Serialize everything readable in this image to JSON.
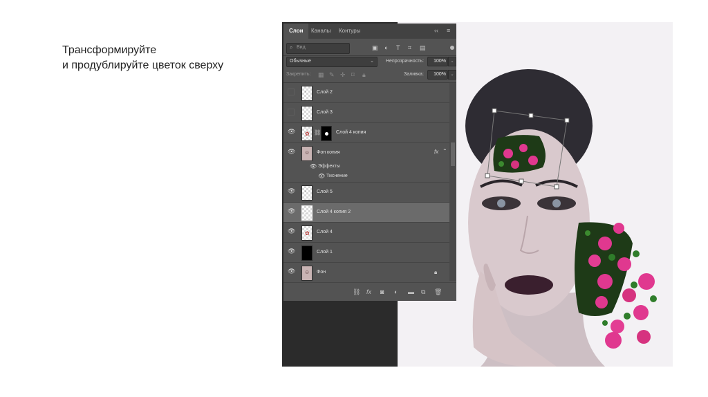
{
  "caption": {
    "line1": "Трансформируйте",
    "line2": "и продублируйте цветок сверху"
  },
  "panel": {
    "tabs": [
      "Слои",
      "Каналы",
      "Контуры"
    ],
    "collapse_glyph": "‹‹",
    "menu_glyph": "≡",
    "search": {
      "icon": "⌕",
      "placeholder": "Вид"
    },
    "filter_icons": [
      "image-filter-icon",
      "adjustment-filter-icon",
      "type-filter-icon",
      "shape-filter-icon",
      "smartobject-filter-icon"
    ],
    "blend_mode": "Обычные",
    "opacity_label": "Непрозрачность:",
    "opacity_value": "100%",
    "lock_label": "Закрепить:",
    "fill_label": "Заливка:",
    "fill_value": "100%",
    "layers": [
      {
        "name": "Слой 2",
        "visible": false,
        "thumb": "trans"
      },
      {
        "name": "Слой 3",
        "visible": false,
        "thumb": "trans"
      },
      {
        "name": "Слой 4 копия",
        "visible": true,
        "thumb": "trans",
        "mask": true
      },
      {
        "name": "Фон копия",
        "visible": true,
        "thumb": "face",
        "fx": "fx"
      },
      {
        "name": "Слой 5",
        "visible": true,
        "thumb": "trans"
      },
      {
        "name": "Слой 4 копия 2",
        "visible": true,
        "thumb": "trans",
        "selected": true
      },
      {
        "name": "Слой 4",
        "visible": true,
        "thumb": "trans"
      },
      {
        "name": "Слой 1",
        "visible": true,
        "thumb": "black"
      },
      {
        "name": "Фон",
        "visible": true,
        "thumb": "face",
        "locked": true
      }
    ],
    "effects": {
      "label": "Эффекты",
      "item": "Тиснение"
    },
    "footer_icons": [
      "link-icon",
      "fx-icon",
      "mask-icon",
      "adjustment-icon",
      "group-icon",
      "new-layer-icon",
      "trash-icon"
    ]
  },
  "colors": {
    "panel_bg": "#535353",
    "tabbar_bg": "#424242",
    "selected_row": "#6b6b6b",
    "flower_pink": "#e0388f",
    "leaf_green": "#2f7d2a"
  }
}
